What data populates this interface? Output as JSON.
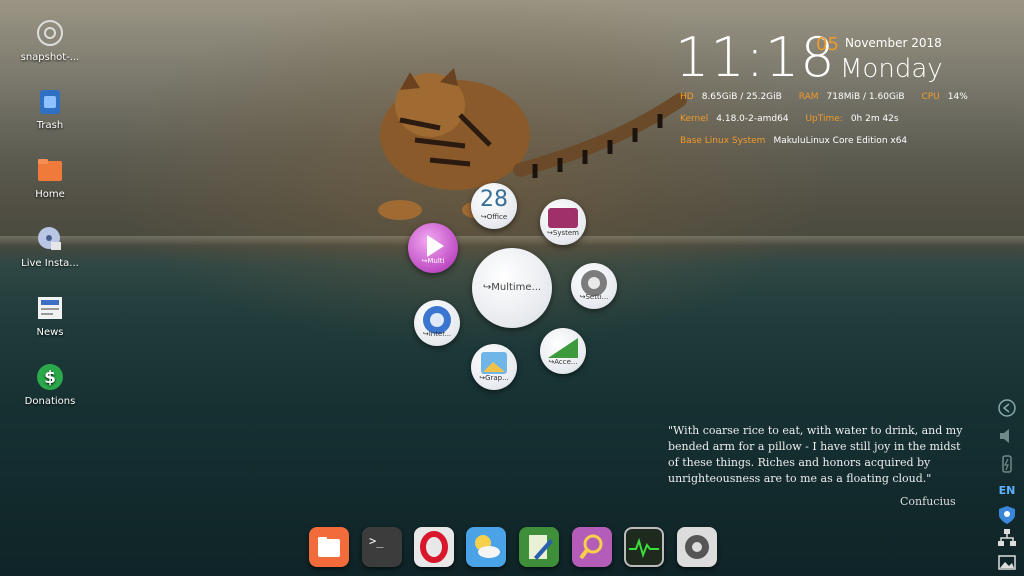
{
  "desktop_icons": [
    {
      "label": "snapshot-...",
      "icon": "camera-icon"
    },
    {
      "label": "Trash",
      "icon": "trash-icon"
    },
    {
      "label": "Home",
      "icon": "home-folder-icon"
    },
    {
      "label": "Live Insta...",
      "icon": "installer-disc-icon"
    },
    {
      "label": "News",
      "icon": "news-icon"
    },
    {
      "label": "Donations",
      "icon": "dollar-icon"
    }
  ],
  "clock": {
    "time": "11:18",
    "day": "05",
    "month_year": "November 2018",
    "weekday": "Monday"
  },
  "system_info": {
    "hd_label": "HD",
    "hd_value": "8.65GiB / 25.2GiB",
    "ram_label": "RAM",
    "ram_value": "718MiB / 1.60GiB",
    "cpu_label": "CPU",
    "cpu_value": "14%",
    "kernel_label": "Kernel",
    "kernel_value": "4.18.0-2-amd64",
    "uptime_label": "UpTime:",
    "uptime_value": "0h 2m 42s",
    "base_label": "Base Linux System",
    "base_value": "MakuluLinux Core Edition x64"
  },
  "launcher": {
    "center": "↪Multime...",
    "items": [
      {
        "label": "↪Office",
        "icon": "calendar-icon",
        "text": "28"
      },
      {
        "label": "↪System",
        "icon": "system-icon"
      },
      {
        "label": "↪Setti...",
        "icon": "settings-gear-icon"
      },
      {
        "label": "↪Acce...",
        "icon": "accessories-icon"
      },
      {
        "label": "↪Grap...",
        "icon": "graphics-icon"
      },
      {
        "label": "↪Inter...",
        "icon": "internet-globe-icon"
      },
      {
        "label": "↪Multi",
        "icon": "play-icon"
      }
    ]
  },
  "quote": {
    "text": "\"With coarse rice to eat, with water to drink, and my bended arm for a pillow - I have still joy in the midst of these things. Riches and honors acquired by unrighteousness are to me as a floating cloud.\"",
    "author": "Confucius"
  },
  "tray": {
    "language": "EN"
  },
  "dock": [
    {
      "name": "files",
      "icon": "folder-icon",
      "color": "#f26b3a"
    },
    {
      "name": "terminal",
      "icon": "terminal-icon",
      "color": "#3c3c3c",
      "text": ">_"
    },
    {
      "name": "opera",
      "icon": "opera-icon",
      "color": "#e8e8e8"
    },
    {
      "name": "weather",
      "icon": "weather-icon",
      "color": "#4aa3e6"
    },
    {
      "name": "editor",
      "icon": "text-editor-icon",
      "color": "#3f8f3a"
    },
    {
      "name": "search",
      "icon": "search-tool-icon",
      "color": "#b35db9"
    },
    {
      "name": "system-monitor",
      "icon": "monitor-icon",
      "color": "#1e2a1e"
    },
    {
      "name": "settings",
      "icon": "settings-icon",
      "color": "#dcdcdc"
    }
  ],
  "colors": {
    "accent": "#f19a2a",
    "lang": "#5fb2ff"
  }
}
